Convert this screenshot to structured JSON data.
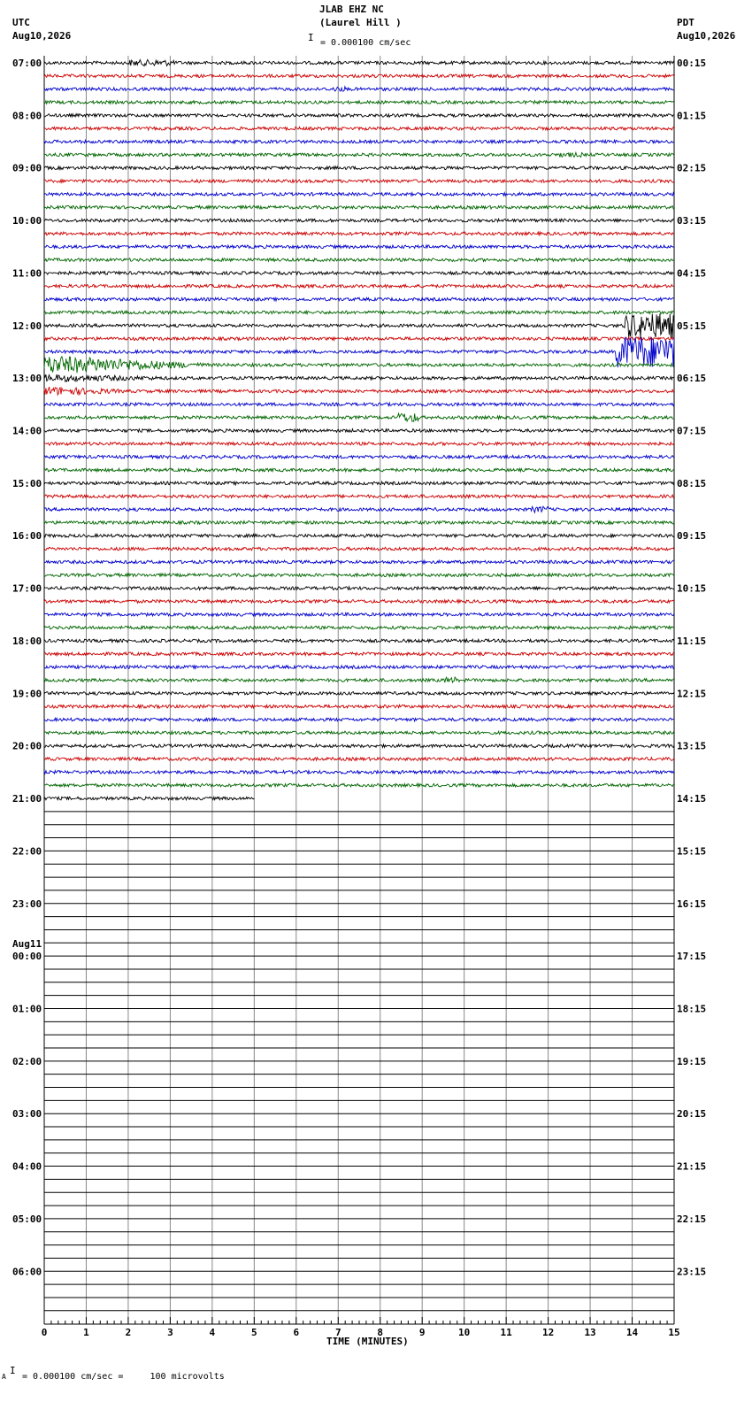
{
  "header": {
    "station": "JLAB EHZ NC",
    "location": "(Laurel Hill )",
    "scale": "= 0.000100 cm/sec",
    "left_zone": "UTC",
    "left_date": "Aug10,2026",
    "right_zone": "PDT",
    "right_date": "Aug10,2026"
  },
  "footer": {
    "prefix": "A",
    "scale": "= 0.000100 cm/sec =     100 microvolts"
  },
  "chart_data": {
    "type": "line",
    "xlabel": "TIME (MINUTES)",
    "xlim": [
      0,
      15
    ],
    "x_ticks": [
      "0",
      "1",
      "2",
      "3",
      "4",
      "5",
      "6",
      "7",
      "8",
      "9",
      "10",
      "11",
      "12",
      "13",
      "14",
      "15"
    ],
    "rows_per_hour": 4,
    "trace_colors": [
      "#000000",
      "#cc0000",
      "#0000cc",
      "#006600"
    ],
    "left_labels": [
      {
        "row": 0,
        "text": "07:00"
      },
      {
        "row": 4,
        "text": "08:00"
      },
      {
        "row": 8,
        "text": "09:00"
      },
      {
        "row": 12,
        "text": "10:00"
      },
      {
        "row": 16,
        "text": "11:00"
      },
      {
        "row": 20,
        "text": "12:00"
      },
      {
        "row": 24,
        "text": "13:00"
      },
      {
        "row": 28,
        "text": "14:00"
      },
      {
        "row": 32,
        "text": "15:00"
      },
      {
        "row": 36,
        "text": "16:00"
      },
      {
        "row": 40,
        "text": "17:00"
      },
      {
        "row": 44,
        "text": "18:00"
      },
      {
        "row": 48,
        "text": "19:00"
      },
      {
        "row": 52,
        "text": "20:00"
      },
      {
        "row": 56,
        "text": "21:00"
      },
      {
        "row": 60,
        "text": "22:00"
      },
      {
        "row": 64,
        "text": "23:00"
      },
      {
        "row": 68,
        "text": "00:00",
        "date": "Aug11"
      },
      {
        "row": 72,
        "text": "01:00"
      },
      {
        "row": 76,
        "text": "02:00"
      },
      {
        "row": 80,
        "text": "03:00"
      },
      {
        "row": 84,
        "text": "04:00"
      },
      {
        "row": 88,
        "text": "05:00"
      },
      {
        "row": 92,
        "text": "06:00"
      }
    ],
    "right_labels": [
      "00:15",
      "01:15",
      "02:15",
      "03:15",
      "04:15",
      "05:15",
      "06:15",
      "07:15",
      "08:15",
      "09:15",
      "10:15",
      "11:15",
      "12:15",
      "13:15",
      "14:15",
      "15:15",
      "16:15",
      "17:15",
      "18:15",
      "19:15",
      "20:15",
      "21:15",
      "22:15",
      "23:15"
    ],
    "total_rows": 96,
    "recorded_rows": 57,
    "last_row_end_minute": 5.0,
    "events": [
      {
        "row": 0,
        "start": 2.0,
        "end": 3.1,
        "amp": 2.0
      },
      {
        "row": 2,
        "start": 6.8,
        "end": 7.2,
        "amp": 1.6
      },
      {
        "row": 7,
        "start": 12.2,
        "end": 12.8,
        "amp": 1.5
      },
      {
        "row": 23,
        "start": 0.0,
        "end": 4.0,
        "amp": 6.0,
        "decay": true
      },
      {
        "row": 24,
        "start": 0.0,
        "end": 3.0,
        "amp": 2.5,
        "decay": true
      },
      {
        "row": 25,
        "start": 0.0,
        "end": 2.0,
        "amp": 3.0,
        "decay": true
      },
      {
        "row": 22,
        "start": 13.6,
        "end": 15.0,
        "amp": 10.0
      },
      {
        "row": 20,
        "start": 13.8,
        "end": 15.0,
        "amp": 8.0
      },
      {
        "row": 27,
        "start": 8.4,
        "end": 8.9,
        "amp": 3.0
      },
      {
        "row": 34,
        "start": 11.6,
        "end": 12.0,
        "amp": 2.0
      },
      {
        "row": 47,
        "start": 9.5,
        "end": 9.8,
        "amp": 2.0
      }
    ]
  }
}
